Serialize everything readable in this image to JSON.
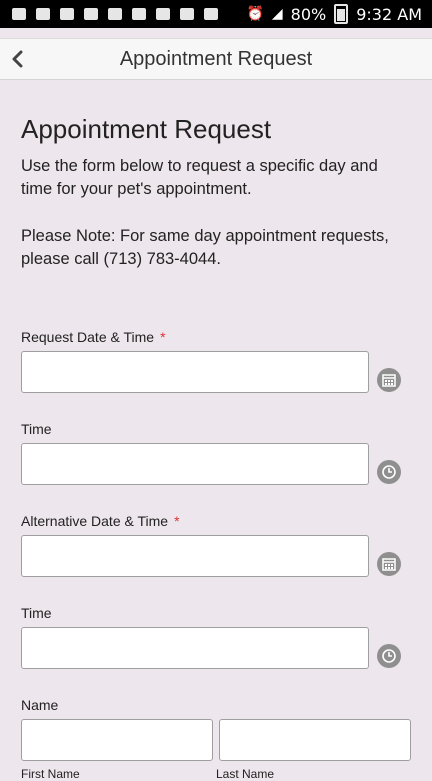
{
  "status_bar": {
    "battery_percent": "80%",
    "time": "9:32 AM",
    "left_icons": [
      "email-icon",
      "email-icon",
      "image-icon",
      "wifi-calling-icon",
      "missed-call-icon",
      "notification-icon",
      "email-icon",
      "voicemail-icon",
      "photo-icon"
    ],
    "right_icons": [
      "alarm-icon",
      "lte-signal-icon",
      "battery-icon"
    ]
  },
  "app_bar": {
    "title": "Appointment Request"
  },
  "page": {
    "title": "Appointment Request",
    "intro": "Use the form below to request a specific day and time for your pet's appointment.",
    "note": "Please Note: For same day appointment requests, please call (713) 783-4044."
  },
  "form": {
    "fields": [
      {
        "label": "Request Date & Time",
        "required_mark": "*",
        "picker_icon": "calendar-icon",
        "value": ""
      },
      {
        "label": "Time",
        "required_mark": "",
        "picker_icon": "clock-icon",
        "value": ""
      },
      {
        "label": "Alternative Date & Time",
        "required_mark": "*",
        "picker_icon": "calendar-icon",
        "value": ""
      },
      {
        "label": "Time",
        "required_mark": "",
        "picker_icon": "clock-icon",
        "value": ""
      }
    ],
    "name": {
      "label": "Name",
      "first_sublabel": "First Name",
      "last_sublabel": "Last Name",
      "first_value": "",
      "last_value": ""
    }
  },
  "colors": {
    "background": "#ede6ec",
    "required": "#dd3333",
    "icon_gray": "#8f8f8f"
  }
}
